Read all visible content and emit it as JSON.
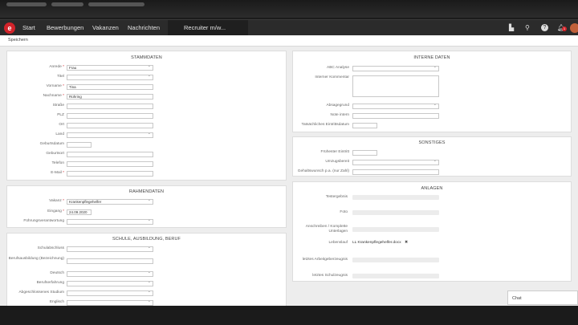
{
  "nav": {
    "logo": "e",
    "items": [
      "Start",
      "Bewerbungen",
      "Vakanzen",
      "Nachrichten"
    ],
    "active_tab": "Recruiter m/w...",
    "icons": [
      "bookmark-icon",
      "search-icon",
      "help-icon",
      "bell-icon",
      "avatar"
    ],
    "notification_count": "1"
  },
  "toolbar": {
    "save_label": "Speichern"
  },
  "stammdaten": {
    "title": "STAMMDATEN",
    "anrede_label": "Anrede",
    "anrede_value": "Frau",
    "titel_label": "Titel",
    "vorname_label": "Vorname",
    "vorname_value": "Tina",
    "nachname_label": "Nachname",
    "nachname_value": "Rühring",
    "strasse_label": "Straße",
    "plz_label": "PLZ",
    "ort_label": "Ort",
    "land_label": "Land",
    "geburtsdatum_label": "Geburtsdatum",
    "geburtsort_label": "Geburtsort",
    "telefon_label": "Telefon",
    "email_label": "E-Mail"
  },
  "rahmendaten": {
    "title": "RAHMENDATEN",
    "vakanz_label": "Vakanz",
    "vakanz_value": "Krankenpflegehelfer",
    "eingang_label": "Eingang",
    "eingang_value": "24.09.2020",
    "fuehrung_label": "Führungsverantwortung"
  },
  "schule": {
    "title": "SCHULE, AUSBILDUNG, BERUF",
    "schulabschluss_label": "Schulabschluss",
    "berufsausbildung_label": "Berufsausbildung (Bezeichnung)",
    "deutsch_label": "Deutsch",
    "berufserfahrung_label": "Berufserfahrung",
    "studium_label": "Abgeschlossenes Studium",
    "englisch_label": "Englisch"
  },
  "interne_daten": {
    "title": "INTERNE DATEN",
    "abc_label": "ABC Analyse",
    "kommentar_label": "Interner Kommentar",
    "absagegrund_label": "Absagegrund",
    "note_label": "Note intern",
    "eintritt_label": "Tatsächliches Eintrittsdatum"
  },
  "sonstiges": {
    "title": "SONSTIGES",
    "eintritt_label": "Frühester Eintritt",
    "umzug_label": "Umzugsbereit",
    "gehalt_label": "Gehaltswunsch p.a. (nur Zahl)"
  },
  "anlagen": {
    "title": "ANLAGEN",
    "testergebnis_label": "Testergebnis",
    "foto_label": "Foto",
    "anschreiben_label": "Anschreiben / Komplette Unterlagen",
    "lebenslauf_label": "Lebenslauf",
    "lebenslauf_value": "LL Krankenpflegehelfer.docx",
    "arbeitszeugnis_label": "letztes Arbeitgeberzeugnis",
    "schulzeugnis_label": "letztes Schulzeugnis"
  },
  "chat": {
    "label": "Chat"
  },
  "colors": {
    "brand": "#d2232a",
    "navbar": "#2b2b2b",
    "background": "#ededed"
  }
}
